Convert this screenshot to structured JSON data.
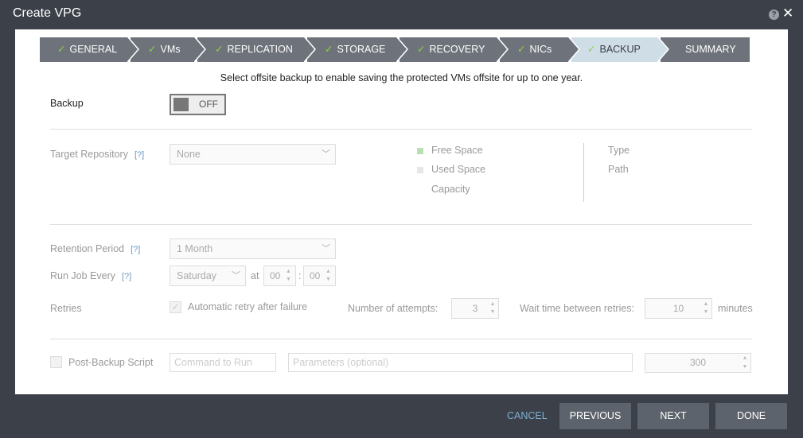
{
  "window": {
    "title": "Create VPG"
  },
  "wizard": {
    "steps": [
      {
        "label": "GENERAL",
        "checked": true
      },
      {
        "label": "VMs",
        "checked": true
      },
      {
        "label": "REPLICATION",
        "checked": true
      },
      {
        "label": "STORAGE",
        "checked": true
      },
      {
        "label": "RECOVERY",
        "checked": true
      },
      {
        "label": "NICs",
        "checked": true
      },
      {
        "label": "BACKUP",
        "checked": true,
        "active": true
      },
      {
        "label": "SUMMARY",
        "checked": false
      }
    ]
  },
  "main": {
    "description": "Select offsite backup to enable saving the protected VMs offsite for up to one year.",
    "backup": {
      "label": "Backup",
      "toggle_state": "OFF"
    },
    "repository": {
      "label": "Target Repository",
      "help": "[?]",
      "selected": "None",
      "free_space_label": "Free Space",
      "used_space_label": "Used Space",
      "capacity_label": "Capacity",
      "type_label": "Type",
      "path_label": "Path"
    },
    "retention": {
      "label": "Retention Period",
      "help": "[?]",
      "selected": "1 Month"
    },
    "run_job": {
      "label": "Run Job Every",
      "help": "[?]",
      "day": "Saturday",
      "at_label": "at",
      "hour": "00",
      "separator": ":",
      "minute": "00"
    },
    "retries": {
      "label": "Retries",
      "auto_retry_label": "Automatic retry after failure",
      "attempts_label": "Number of attempts:",
      "attempts_value": "3",
      "wait_label": "Wait time between retries:",
      "wait_value": "10",
      "wait_unit": "minutes"
    },
    "post_script": {
      "label": "Post-Backup Script",
      "command_placeholder": "Command to Run",
      "params_placeholder": "Parameters (optional)",
      "timeout_value": "300"
    }
  },
  "footer": {
    "cancel": "CANCEL",
    "previous": "PREVIOUS",
    "next": "NEXT",
    "done": "DONE"
  },
  "colors": {
    "titlebar": "#3b4049",
    "step_inactive": "#6e737b",
    "step_active": "#cfdde7",
    "check": "#8ed13d",
    "button": "#5d636c",
    "cancel_link": "#7fb0d2",
    "free_space": "#b9dfb4",
    "used_space": "#e6e6e6"
  },
  "icons": {
    "help": "help-icon",
    "close": "close-icon",
    "check": "check-icon",
    "caret": "chevron-down-icon"
  }
}
